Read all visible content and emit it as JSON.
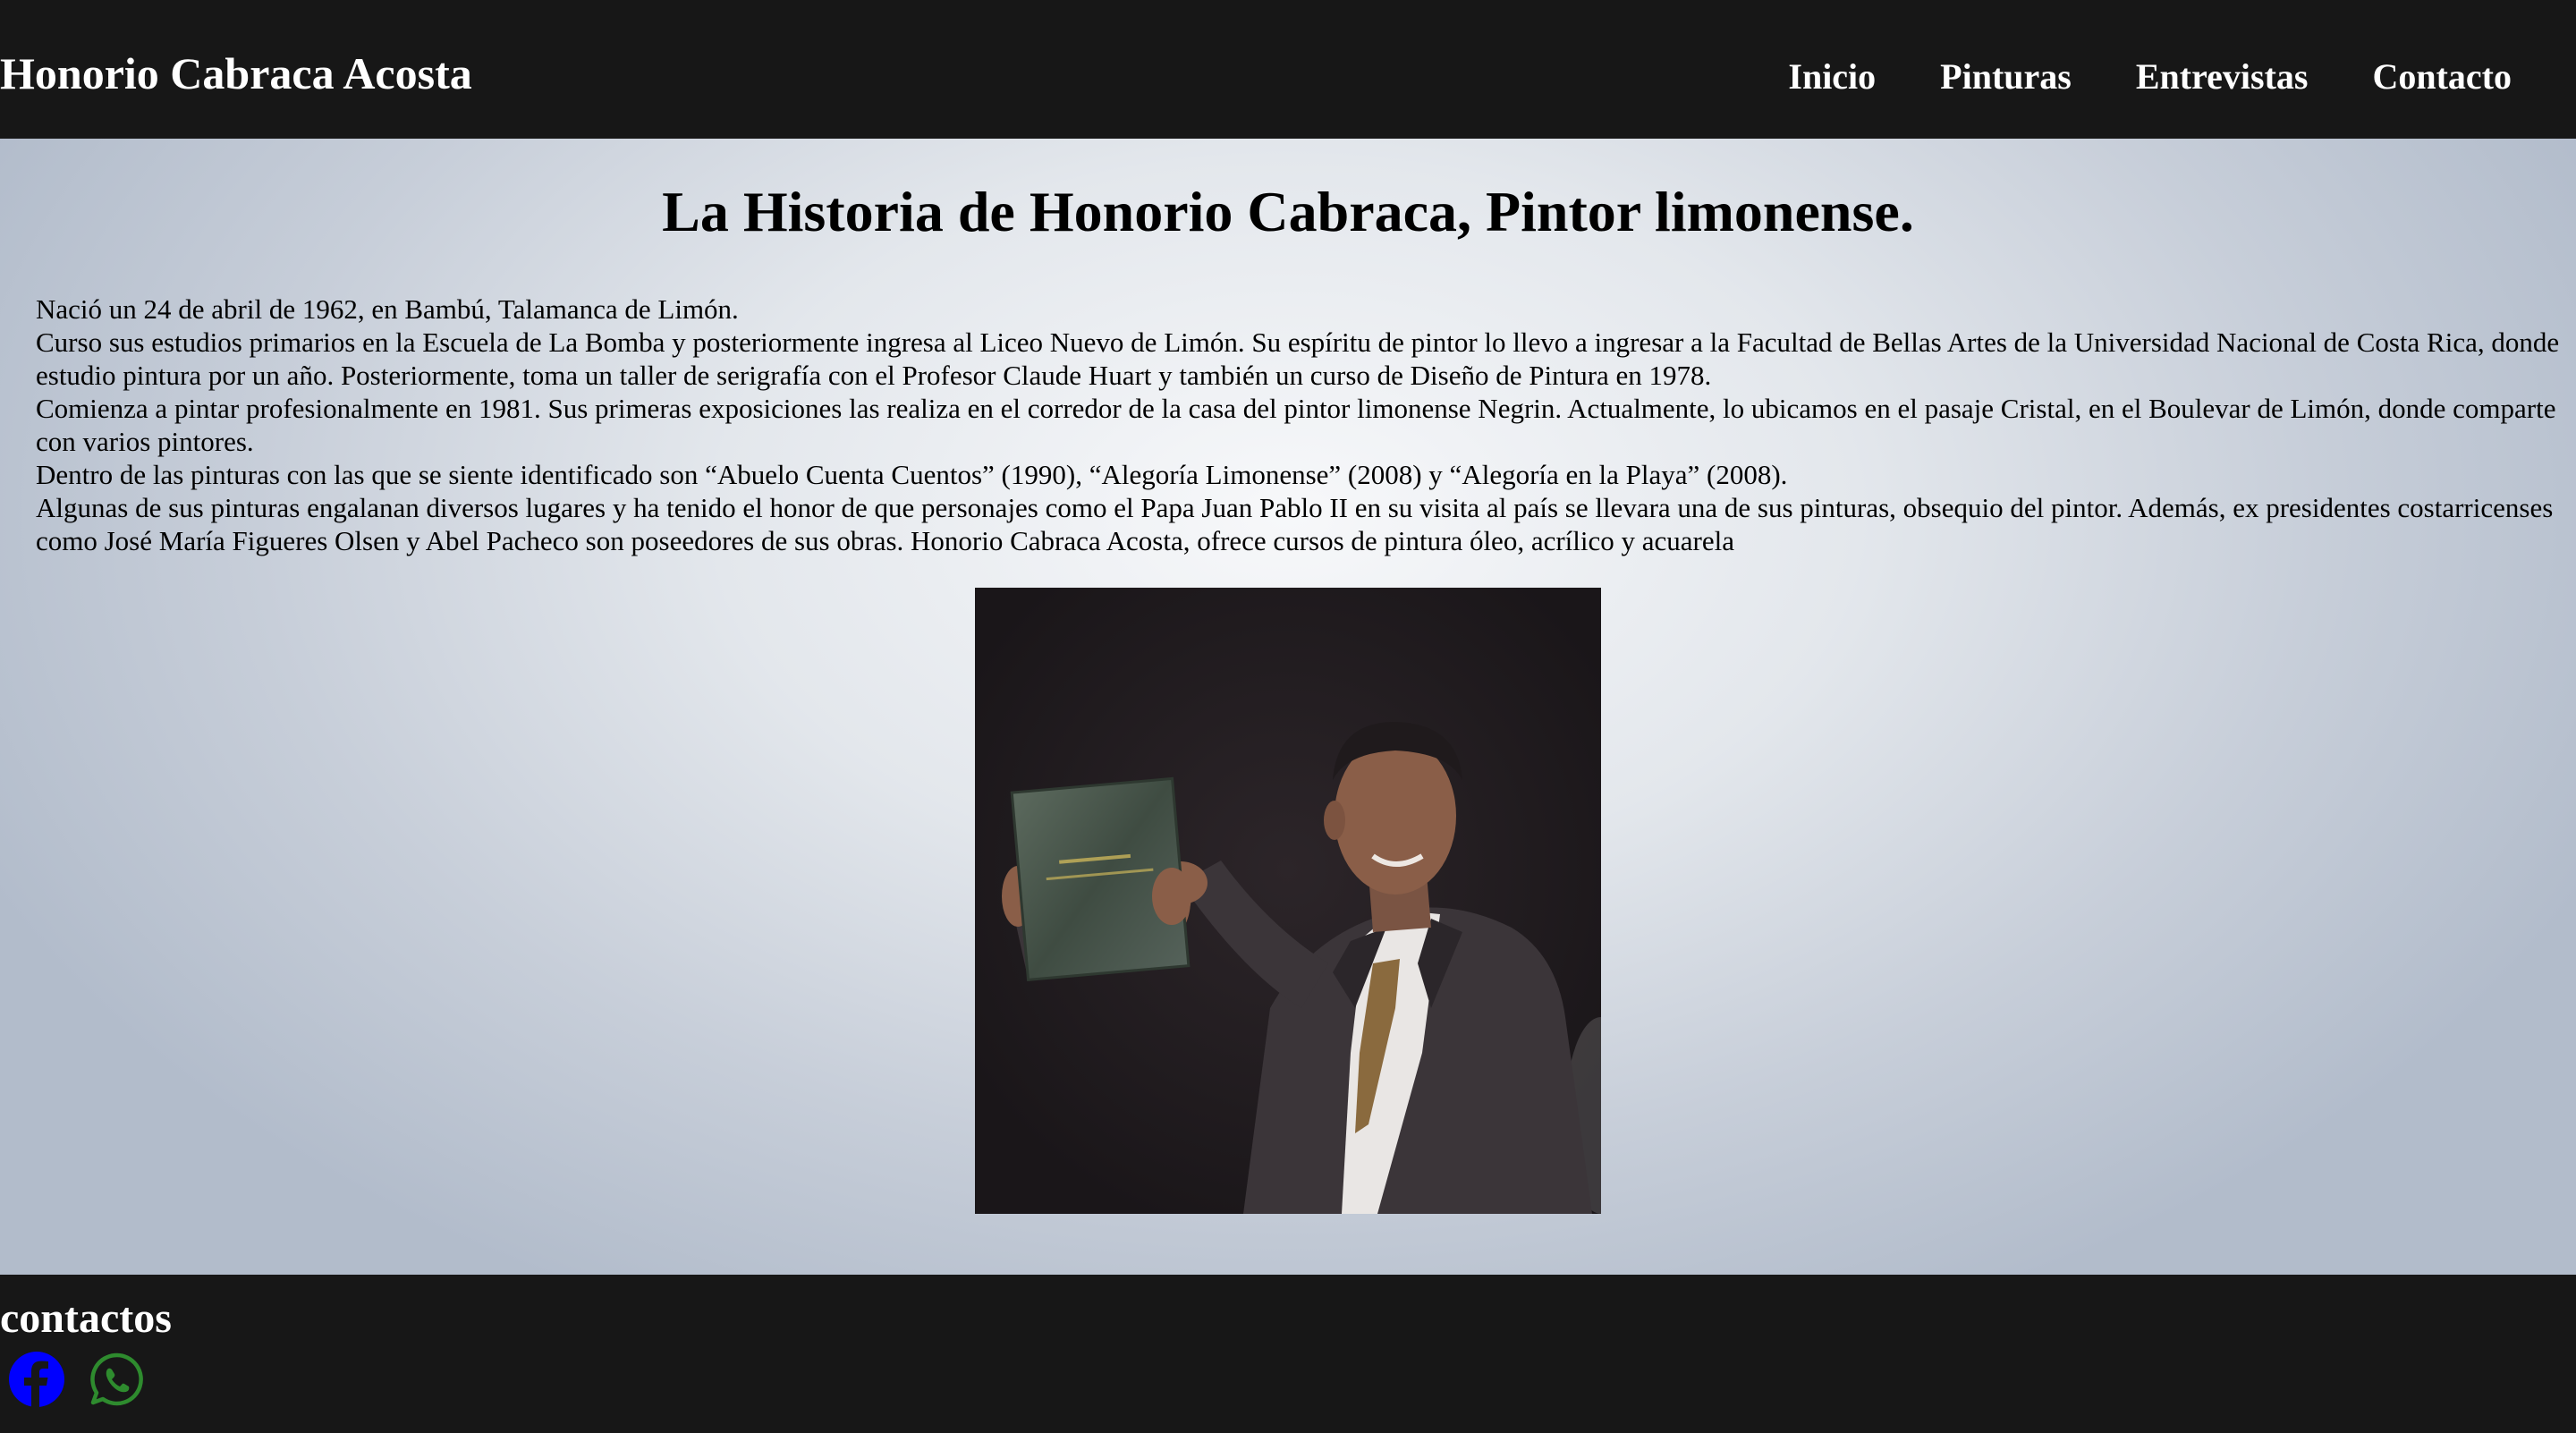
{
  "site": {
    "brand": "Honorio Cabraca Acosta"
  },
  "nav": {
    "items": [
      {
        "label": "Inicio"
      },
      {
        "label": "Pinturas"
      },
      {
        "label": "Entrevistas"
      },
      {
        "label": "Contacto"
      }
    ]
  },
  "main": {
    "title": "La Historia de Honorio Cabraca, Pintor limonense.",
    "paragraphs": [
      "Nació un 24 de abril de 1962, en Bambú, Talamanca de Limón.",
      "Curso sus estudios primarios en la Escuela de La Bomba y posteriormente ingresa al Liceo Nuevo de Limón. Su espíritu de pintor lo llevo a ingresar a la Facultad de Bellas Artes de la Universidad Nacional de Costa Rica, donde estudio pintura por un año. Posteriormente, toma un taller de serigrafía con el Profesor Claude Huart y también un curso de Diseño de Pintura en 1978.",
      "Comienza a pintar profesionalmente en 1981. Sus primeras exposiciones las realiza en el corredor de la casa del pintor limonense Negrin. Actualmente, lo ubicamos en el pasaje Cristal, en el Boulevar de Limón, donde comparte con varios pintores.",
      "Dentro de las pinturas con las que se siente identificado son “Abuelo Cuenta Cuentos” (1990), “Alegoría Limonense” (2008) y “Alegoría en la Playa” (2008).",
      "Algunas de sus pinturas engalanan diversos lugares y ha tenido el honor de que personajes como el Papa Juan Pablo II en su visita al país se llevara una de sus pinturas, obsequio del pintor. Además, ex presidentes costarricenses como José María Figueres Olsen y Abel Pacheco son poseedores de sus obras. Honorio Cabraca Acosta, ofrece cursos de pintura óleo, acrílico y acuarela"
    ]
  },
  "footer": {
    "title": "contactos",
    "social": [
      {
        "icon": "facebook-icon",
        "color": "#0000ff"
      },
      {
        "icon": "whatsapp-icon",
        "color": "#2e8b2e"
      }
    ]
  },
  "colors": {
    "bar": "#171717",
    "text_light": "#ffffff",
    "text_dark": "#000000"
  }
}
